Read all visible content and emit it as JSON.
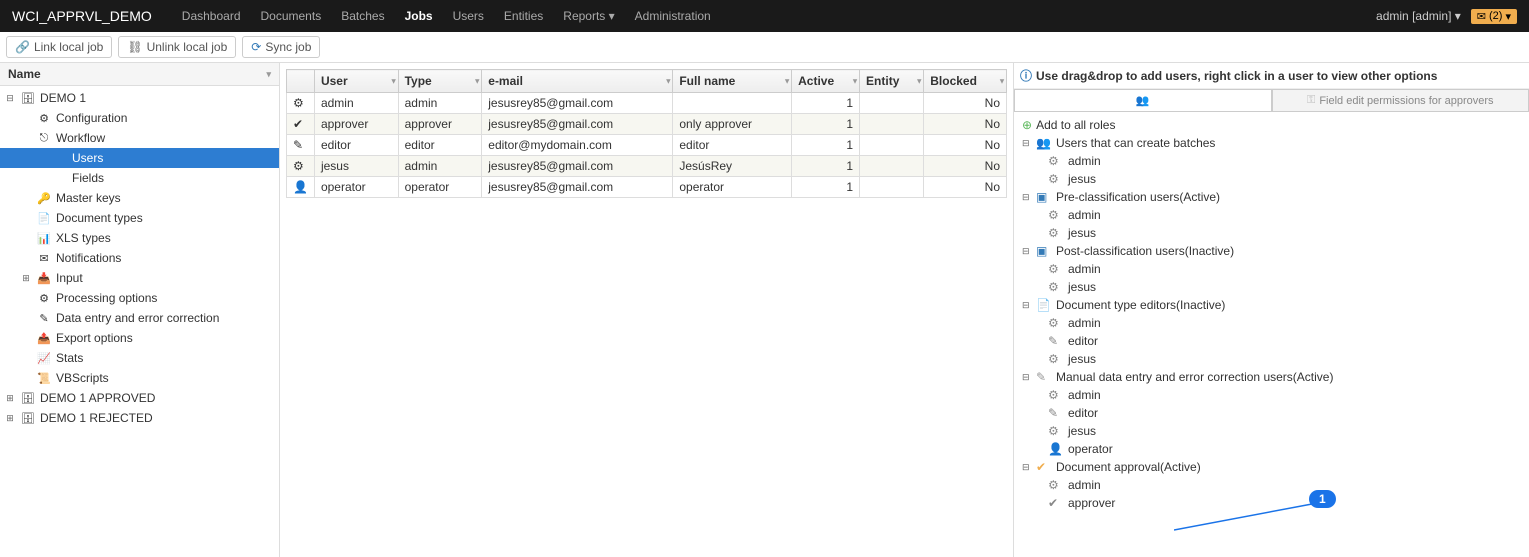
{
  "navbar": {
    "brand": "WCI_APPRVL_DEMO",
    "links": [
      "Dashboard",
      "Documents",
      "Batches",
      "Jobs",
      "Users",
      "Entities",
      "Reports",
      "Administration"
    ],
    "active_link": "Jobs",
    "user_label": "admin [admin]",
    "mail_count": "(2)"
  },
  "toolbar": {
    "link_local": "Link local job",
    "unlink_local": "Unlink local job",
    "sync": "Sync job"
  },
  "sidebar": {
    "header": "Name",
    "nodes": [
      {
        "label": "DEMO 1",
        "indent": 0,
        "icon": "db",
        "toggle": "⊟"
      },
      {
        "label": "Configuration",
        "indent": 1,
        "icon": "gear"
      },
      {
        "label": "Workflow",
        "indent": 1,
        "icon": "flow"
      },
      {
        "label": "Users",
        "indent": 2,
        "selected": true
      },
      {
        "label": "Fields",
        "indent": 2
      },
      {
        "label": "Master keys",
        "indent": 1,
        "icon": "key"
      },
      {
        "label": "Document types",
        "indent": 1,
        "icon": "doc"
      },
      {
        "label": "XLS types",
        "indent": 1,
        "icon": "xls"
      },
      {
        "label": "Notifications",
        "indent": 1,
        "icon": "mail"
      },
      {
        "label": "Input",
        "indent": 1,
        "icon": "input",
        "toggle": "⊞"
      },
      {
        "label": "Processing options",
        "indent": 1,
        "icon": "proc"
      },
      {
        "label": "Data entry and error correction",
        "indent": 1,
        "icon": "data"
      },
      {
        "label": "Export options",
        "indent": 1,
        "icon": "export"
      },
      {
        "label": "Stats",
        "indent": 1,
        "icon": "stats"
      },
      {
        "label": "VBScripts",
        "indent": 1,
        "icon": "script"
      },
      {
        "label": "DEMO 1 APPROVED",
        "indent": 0,
        "icon": "db",
        "toggle": "⊞"
      },
      {
        "label": "DEMO 1 REJECTED",
        "indent": 0,
        "icon": "db",
        "toggle": "⊞"
      }
    ]
  },
  "grid": {
    "columns": [
      "User",
      "Type",
      "e-mail",
      "Full name",
      "Active",
      "Entity",
      "Blocked"
    ],
    "rows": [
      {
        "icon": "gear",
        "user": "admin",
        "type": "admin",
        "email": "jesusrey85@gmail.com",
        "fullname": "",
        "active": "1",
        "entity": "",
        "blocked": "No"
      },
      {
        "icon": "approve",
        "user": "approver",
        "type": "approver",
        "email": "jesusrey85@gmail.com",
        "fullname": "only approver",
        "active": "1",
        "entity": "",
        "blocked": "No"
      },
      {
        "icon": "edit",
        "user": "editor",
        "type": "editor",
        "email": "editor@mydomain.com",
        "fullname": "editor",
        "active": "1",
        "entity": "",
        "blocked": "No"
      },
      {
        "icon": "gear",
        "user": "jesus",
        "type": "admin",
        "email": "jesusrey85@gmail.com",
        "fullname": "JesúsRey",
        "active": "1",
        "entity": "",
        "blocked": "No"
      },
      {
        "icon": "person",
        "user": "operator",
        "type": "operator",
        "email": "jesusrey85@gmail.com",
        "fullname": "operator",
        "active": "1",
        "entity": "",
        "blocked": "No"
      }
    ]
  },
  "right": {
    "info": "Use drag&drop to add users, right click in a user to view other options",
    "tabs": {
      "roles_icon": "users-icon",
      "perm_label": "Field edit permissions for approvers"
    },
    "add_all": "Add to all roles",
    "groups": [
      {
        "label": "Users that can create batches",
        "status": "",
        "icon": "users",
        "color": "#f0ad4e",
        "items": [
          {
            "label": "admin",
            "icon": "gear"
          },
          {
            "label": "jesus",
            "icon": "gear"
          }
        ]
      },
      {
        "label": "Pre-classification users",
        "status": "(Active)",
        "icon": "batch",
        "color": "#337ab7",
        "items": [
          {
            "label": "admin",
            "icon": "gear"
          },
          {
            "label": "jesus",
            "icon": "gear"
          }
        ]
      },
      {
        "label": "Post-classification users",
        "status": "(Inactive)",
        "icon": "batch",
        "color": "#337ab7",
        "items": [
          {
            "label": "admin",
            "icon": "gear"
          },
          {
            "label": "jesus",
            "icon": "gear"
          }
        ]
      },
      {
        "label": "Document type editors",
        "status": "(Inactive)",
        "icon": "doc",
        "color": "#d9534f",
        "items": [
          {
            "label": "admin",
            "icon": "gear"
          },
          {
            "label": "editor",
            "icon": "edit"
          },
          {
            "label": "jesus",
            "icon": "gear"
          }
        ]
      },
      {
        "label": "Manual data entry and error correction users",
        "status": "(Active)",
        "icon": "data",
        "color": "#999",
        "items": [
          {
            "label": "admin",
            "icon": "gear"
          },
          {
            "label": "editor",
            "icon": "edit"
          },
          {
            "label": "jesus",
            "icon": "gear"
          },
          {
            "label": "operator",
            "icon": "person"
          }
        ]
      },
      {
        "label": "Document approval",
        "status": "(Active)",
        "icon": "approve",
        "color": "#f0ad4e",
        "items": [
          {
            "label": "admin",
            "icon": "gear"
          },
          {
            "label": "approver",
            "icon": "approve"
          }
        ]
      }
    ],
    "annotation": "1"
  }
}
